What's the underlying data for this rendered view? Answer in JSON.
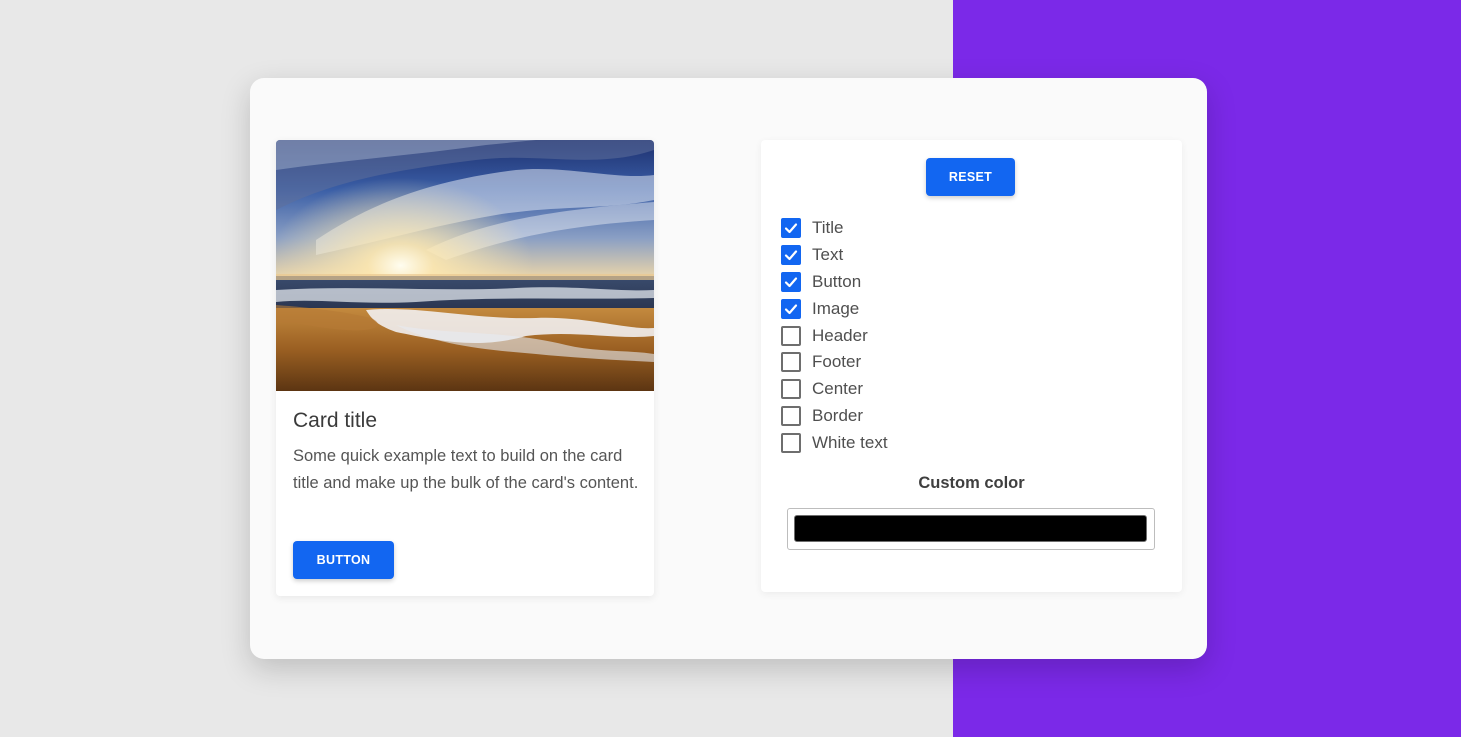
{
  "card": {
    "title": "Card title",
    "text": "Some quick example text to build on the card title and make up the bulk of the card's content.",
    "button_label": "Button",
    "image_icon": "beach-sunset-image"
  },
  "settings": {
    "reset_label": "Reset",
    "options": [
      {
        "label": "Title",
        "checked": true
      },
      {
        "label": "Text",
        "checked": true
      },
      {
        "label": "Button",
        "checked": true
      },
      {
        "label": "Image",
        "checked": true
      },
      {
        "label": "Header",
        "checked": false
      },
      {
        "label": "Footer",
        "checked": false
      },
      {
        "label": "Center",
        "checked": false
      },
      {
        "label": "Border",
        "checked": false
      },
      {
        "label": "White text",
        "checked": false
      }
    ],
    "custom_color_label": "Custom color",
    "custom_color_value": "#000000"
  },
  "colors": {
    "primary": "#1266f1",
    "accent_background": "#7b29e8",
    "page_background": "#e8e8e8"
  }
}
